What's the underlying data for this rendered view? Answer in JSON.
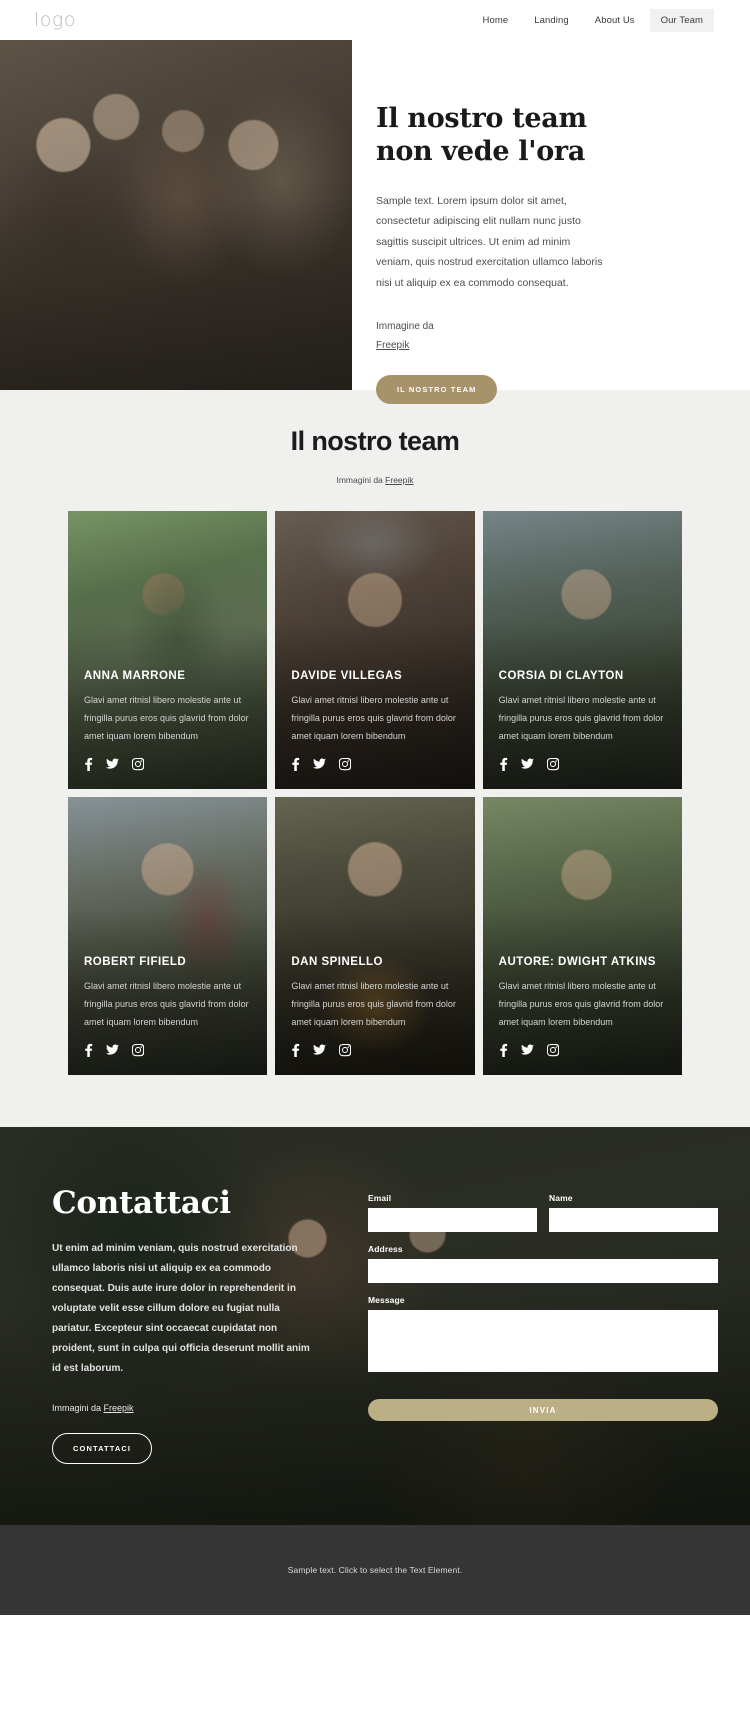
{
  "header": {
    "logo": "logo",
    "nav": [
      {
        "label": "Home",
        "active": false
      },
      {
        "label": "Landing",
        "active": false
      },
      {
        "label": "About Us",
        "active": false
      },
      {
        "label": "Our Team",
        "active": true
      }
    ]
  },
  "hero": {
    "title_line1": "Il nostro team",
    "title_line2": "non vede l'ora",
    "body": "Sample text. Lorem ipsum dolor sit amet, consectetur adipiscing elit nullam nunc justo sagittis suscipit ultrices. Ut enim ad minim veniam, quis nostrud exercitation ullamco laboris nisi ut aliquip ex ea commodo consequat.",
    "credit_prefix": "Immagine da",
    "credit_link": "Freepik",
    "cta_label": "IL NOSTRO TEAM",
    "cta_color": "#a8926a"
  },
  "team": {
    "title": "Il nostro team",
    "subtitle_prefix": "Immagini da",
    "subtitle_link": "Freepik",
    "card_body": "Glavi amet ritnisl libero molestie ante ut fringilla purus eros quis glavrid from dolor amet iquam lorem bibendum",
    "social_icons": [
      "facebook-icon",
      "twitter-icon",
      "instagram-icon"
    ],
    "members": [
      {
        "name": "ANNA MARRONE"
      },
      {
        "name": "DAVIDE VILLEGAS"
      },
      {
        "name": "CORSIA DI CLAYTON"
      },
      {
        "name": "ROBERT FIFIELD"
      },
      {
        "name": "DAN SPINELLO"
      },
      {
        "name": "AUTORE: DWIGHT ATKINS"
      }
    ]
  },
  "contact": {
    "title": "Contattaci",
    "body": "Ut enim ad minim veniam, quis nostrud exercitation ullamco laboris nisi ut aliquip ex ea commodo consequat. Duis aute irure dolor in reprehenderit in voluptate velit esse cillum dolore eu fugiat nulla pariatur. Excepteur sint occaecat cupidatat non proident, sunt in culpa qui officia deserunt mollit anim id est laborum.",
    "credit_prefix": "Immagini da",
    "credit_link": "Freepik",
    "cta_label": "CONTATTACI",
    "form": {
      "email_label": "Email",
      "email_value": "",
      "name_label": "Name",
      "name_value": "",
      "address_label": "Address",
      "address_value": "",
      "message_label": "Message",
      "message_value": "",
      "submit_label": "INVIA",
      "submit_color": "#bbaf86"
    }
  },
  "footer": {
    "text": "Sample text. Click to select the Text Element."
  }
}
